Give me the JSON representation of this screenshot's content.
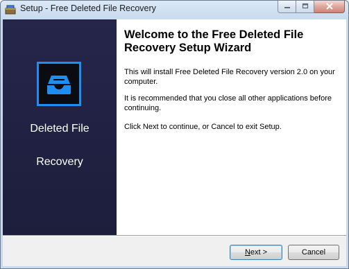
{
  "window": {
    "title": "Setup - Free Deleted File Recovery",
    "icons": {
      "app": "installer-box-icon",
      "minimize": "minimize-icon",
      "maximize": "maximize-icon",
      "close": "close-icon"
    }
  },
  "sidebar": {
    "logo_icon": "inbox-tray-icon",
    "logo_color": "#1e8ff0",
    "product_line1": "Deleted File",
    "product_line2": "Recovery"
  },
  "content": {
    "heading": "Welcome to the Free Deleted File Recovery Setup Wizard",
    "paragraphs": [
      "This will install Free Deleted File Recovery version 2.0 on your computer.",
      "It is recommended that you close all other applications before continuing.",
      "Click Next to continue, or Cancel to exit Setup."
    ]
  },
  "buttons": {
    "next": "Next >",
    "cancel": "Cancel"
  }
}
